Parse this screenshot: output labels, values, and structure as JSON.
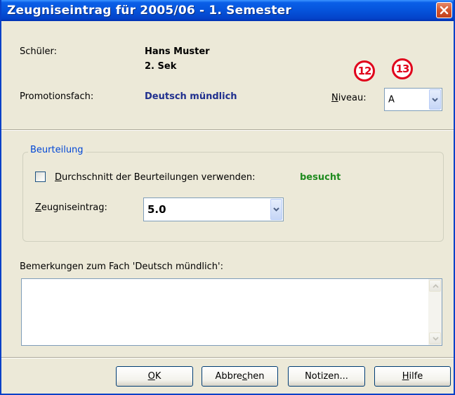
{
  "window": {
    "title": "Zeugniseintrag für 2005/06 - 1. Semester",
    "close_icon": "close-icon"
  },
  "student": {
    "label": "Schüler:",
    "name": "Hans Muster",
    "class": "2. Sek"
  },
  "subject": {
    "label": "Promotionsfach:",
    "value": "Deutsch mündlich"
  },
  "niveau": {
    "label_mnemonic": "N",
    "label_rest": "iveau:",
    "value": "A"
  },
  "annotations": {
    "badge_a": "12",
    "badge_b": "13"
  },
  "assessment": {
    "group_title": "Beurteilung",
    "average_checkbox": {
      "label_mnemonic": "D",
      "label_rest": "urchschnitt der Beurteilungen verwenden:",
      "checked": false
    },
    "status": "besucht",
    "entry": {
      "label_mnemonic": "Z",
      "label_rest": "eugniseintrag:",
      "value": "5.0"
    }
  },
  "remarks": {
    "label": "Bemerkungen zum Fach 'Deutsch mündlich':",
    "value": ""
  },
  "buttons": {
    "ok": {
      "mnemonic": "O",
      "rest": "K"
    },
    "cancel": {
      "before": "Abbre",
      "mnemonic": "c",
      "after": "hen"
    },
    "notes": {
      "label": "Notizen..."
    },
    "help": {
      "mnemonic": "H",
      "rest": "ilfe"
    }
  },
  "colors": {
    "title_bar": "#0553DB",
    "dialog_bg": "#ECE9D8",
    "subject_text": "#1F2F8E",
    "status_text": "#1E8B1E",
    "badge": "#E0001B",
    "group_title": "#0046D5"
  }
}
